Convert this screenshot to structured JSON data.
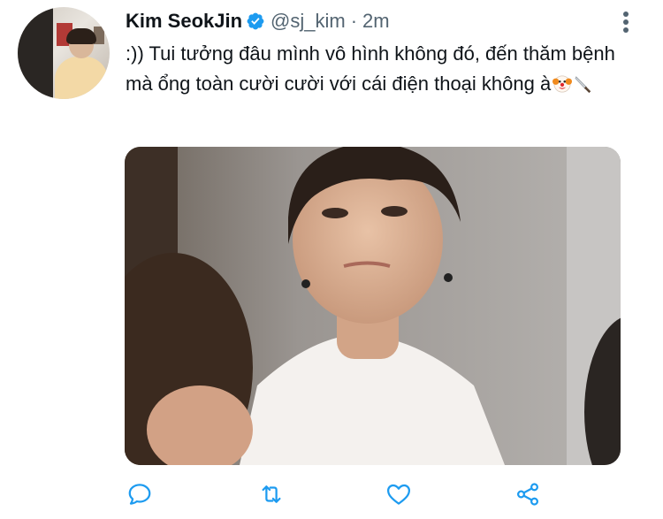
{
  "tweet": {
    "author_name": "Kim SeokJin",
    "handle": "@sj_kim",
    "separator": "·",
    "time": "2m",
    "text": ":)) Tui tưởng đâu mình vô hình không đó, đến thăm bệnh mà ổng toàn cười cười với cái điện thoại không à",
    "emoji_icons": [
      "clown-face-icon",
      "knife-icon"
    ],
    "verified": true
  },
  "actions": [
    "reply-icon",
    "retweet-icon",
    "like-icon",
    "share-icon"
  ],
  "colors": {
    "text": "#0f1419",
    "secondary": "#536471",
    "verified_blue": "#1d9bf0",
    "icon_blue": "#1d9bf0"
  }
}
